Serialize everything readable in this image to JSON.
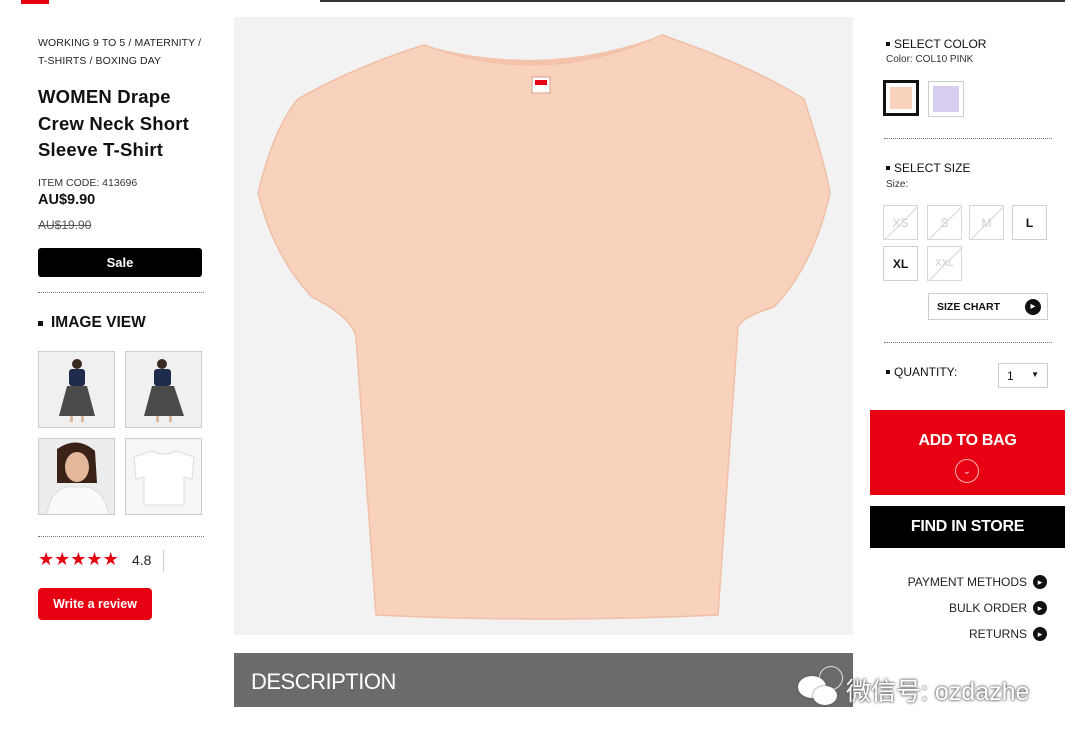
{
  "breadcrumb": [
    "WORKING 9 TO 5",
    "MATERNITY",
    "T-SHIRTS",
    "BOXING DAY"
  ],
  "breadcrumb_sep": "/",
  "product": {
    "title": "WOMEN Drape Crew Neck Short Sleeve T-Shirt",
    "item_code": "ITEM CODE: 413696",
    "price": "AU$9.90",
    "old_price": "AU$19.90",
    "sale_label": "Sale"
  },
  "image_view": {
    "title": "IMAGE VIEW",
    "thumbnails": [
      {
        "name": "model-front-navy-top"
      },
      {
        "name": "model-side-navy-top"
      },
      {
        "name": "model-closeup-white-top"
      },
      {
        "name": "flat-white-tee"
      }
    ]
  },
  "rating": {
    "value": "4.8",
    "stars": 5,
    "review_button": "Write a review"
  },
  "main_image": {
    "name": "pink-drape-tee",
    "color": "#f9d2bd"
  },
  "description": {
    "label": "DESCRIPTION"
  },
  "color_select": {
    "title": "SELECT COLOR",
    "current": "Color: COL10 PINK",
    "swatches": [
      {
        "name": "pink",
        "color": "#f9d2bd",
        "selected": true
      },
      {
        "name": "lavender",
        "color": "#d8cdef",
        "selected": false
      }
    ]
  },
  "size_select": {
    "title": "SELECT SIZE",
    "label": "Size:",
    "sizes": [
      {
        "label": "XS",
        "available": false
      },
      {
        "label": "S",
        "available": false
      },
      {
        "label": "M",
        "available": false
      },
      {
        "label": "L",
        "available": true
      },
      {
        "label": "XL",
        "available": true
      },
      {
        "label": "XXL",
        "available": false
      }
    ],
    "size_chart": "SIZE CHART"
  },
  "quantity": {
    "title": "QUANTITY:",
    "value": "1"
  },
  "actions": {
    "add_to_bag": "ADD TO BAG",
    "find_in_store": "FIND IN STORE"
  },
  "links": [
    "PAYMENT METHODS",
    "BULK ORDER",
    "RETURNS"
  ],
  "watermark": "微信号: ozdazhe",
  "colors": {
    "accent_red": "#e60012",
    "black": "#000000",
    "description_bg": "#6b6b6b"
  }
}
